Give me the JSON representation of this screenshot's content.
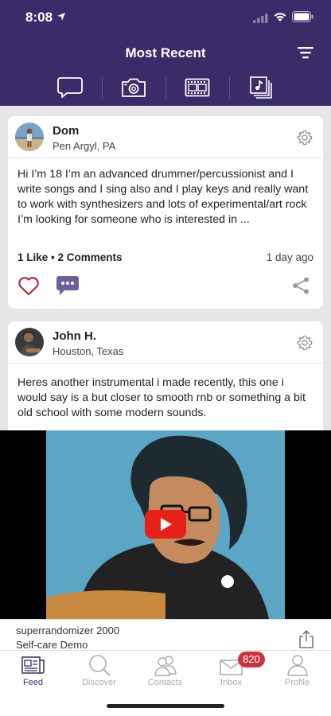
{
  "status_bar": {
    "time": "8:08"
  },
  "header": {
    "title": "Most Recent"
  },
  "media_tabs": [
    "chat-bubble-icon",
    "camera-icon",
    "film-icon",
    "music-library-icon"
  ],
  "posts": [
    {
      "author": "Dom",
      "location": "Pen Argyl, PA",
      "text": "Hi I’m 18 I’m an advanced drummer/percussionist and I write songs and I sing also and I play keys and really want to work with synthesizers and lots of experimental/art rock I’m looking for someone who is interested in ...",
      "stats": "1 Like • 2 Comments",
      "time_ago": "1 day ago"
    },
    {
      "author": "John H.",
      "location": "Houston, Texas",
      "text": "Heres another instrumental i made recently, this one i would say is a but closer to smooth rnb or something a bit old school with some modern sounds."
    }
  ],
  "video": {
    "channel": "superrandomizer 2000",
    "title": "Self-care Demo"
  },
  "tabs": [
    {
      "label": "Feed",
      "icon": "feed-icon",
      "active": true
    },
    {
      "label": "Discover",
      "icon": "search-icon"
    },
    {
      "label": "Contacts",
      "icon": "contacts-icon"
    },
    {
      "label": "Inbox",
      "icon": "mail-icon",
      "badge": "820"
    },
    {
      "label": "Profile",
      "icon": "profile-icon"
    }
  ],
  "colors": {
    "brand": "#3a2c69",
    "like": "#b8283a",
    "badge": "#c9343c"
  }
}
